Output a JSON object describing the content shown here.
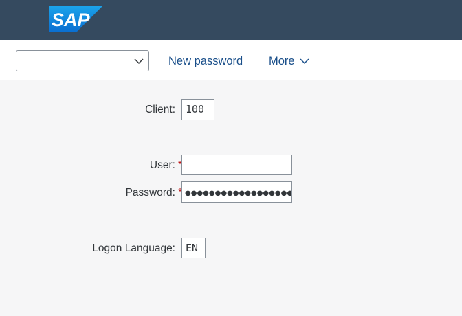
{
  "header": {
    "logo_text": "SAP",
    "logo_color": "#0a6ed1",
    "bg_color": "#354a5f"
  },
  "toolbar": {
    "system_dropdown": {
      "value": ""
    },
    "new_password_label": "New password",
    "more_label": "More",
    "link_color": "#1a4f8a"
  },
  "form": {
    "client_label": "Client:",
    "client_value": "100",
    "user_label": "User:",
    "user_value": "",
    "password_label": "Password:",
    "password_value": "●●●●●●●●●●●●●●●●●●",
    "required_mark": "*",
    "logon_language_label": "Logon Language:",
    "logon_language_value": "EN"
  }
}
